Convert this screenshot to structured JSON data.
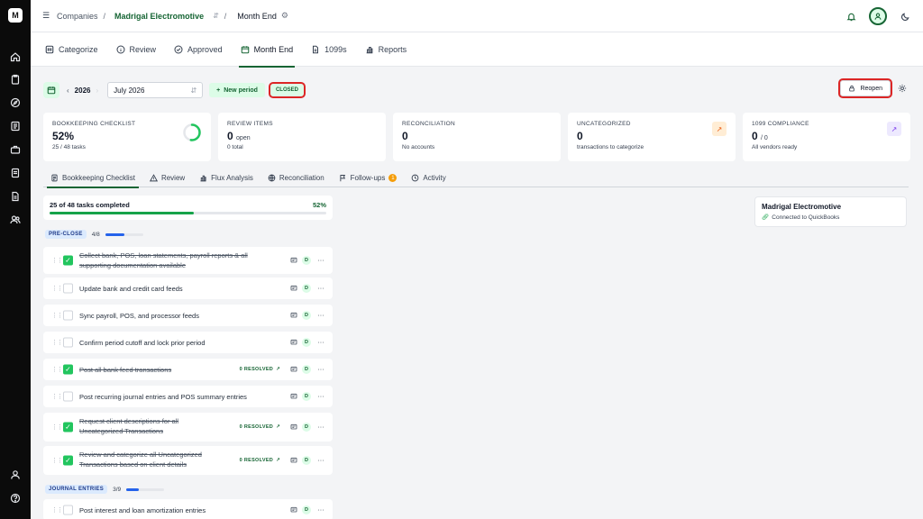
{
  "app": {
    "logo_letter": "M"
  },
  "breadcrumb": {
    "root": "Companies",
    "company": "Madrigal Electromotive",
    "page": "Month End"
  },
  "nav_tabs": [
    {
      "label": "Categorize",
      "icon": "categorize-icon"
    },
    {
      "label": "Review",
      "icon": "info-circle-icon"
    },
    {
      "label": "Approved",
      "icon": "check-circle-icon"
    },
    {
      "label": "Month End",
      "icon": "calendar-icon",
      "active": true
    },
    {
      "label": "1099s",
      "icon": "document-icon"
    },
    {
      "label": "Reports",
      "icon": "bar-chart-icon"
    }
  ],
  "toolbar": {
    "year": "2026",
    "month": "July 2026",
    "new_period_label": "New period",
    "status": "CLOSED",
    "reopen_label": "Reopen"
  },
  "cards": [
    {
      "title": "BOOKKEEPING CHECKLIST",
      "value": "52%",
      "suffix": "",
      "sub": "25 / 48 tasks",
      "progress": 0.52
    },
    {
      "title": "REVIEW ITEMS",
      "value": "0",
      "suffix": "open",
      "sub": "0 total"
    },
    {
      "title": "RECONCILIATION",
      "value": "0",
      "suffix": "",
      "sub": "No accounts"
    },
    {
      "title": "UNCATEGORIZED",
      "value": "0",
      "suffix": "",
      "sub": "transactions to categorize"
    },
    {
      "title": "1099 COMPLIANCE",
      "value": "0",
      "suffix": "/ 0",
      "sub": "All vendors ready"
    }
  ],
  "sub_tabs": [
    {
      "label": "Bookkeeping Checklist",
      "active": true
    },
    {
      "label": "Review"
    },
    {
      "label": "Flux Analysis"
    },
    {
      "label": "Reconciliation"
    },
    {
      "label": "Follow-ups",
      "badge": "1"
    },
    {
      "label": "Activity"
    }
  ],
  "progress": {
    "label": "25 of 48 tasks completed",
    "percent_label": "52%",
    "value": 0.52
  },
  "sections": [
    {
      "tag": "PRE-CLOSE",
      "count": "4/8",
      "value": 0.5
    },
    {
      "tag": "JOURNAL ENTRIES",
      "count": "3/9",
      "value": 0.33
    }
  ],
  "tasks": [
    {
      "line1": "Collect bank, POS, loan statements, payroll reports & all",
      "line2": "supporting documentation available",
      "done": true,
      "resolved": "",
      "assignee": "D"
    },
    {
      "line1": "Update bank and credit card feeds",
      "line2": "",
      "done": false,
      "resolved": "",
      "assignee": "D"
    },
    {
      "line1": "Sync payroll, POS, and processor feeds",
      "line2": "",
      "done": false,
      "resolved": "",
      "assignee": "D"
    },
    {
      "line1": "Confirm period cutoff and lock prior period",
      "line2": "",
      "done": false,
      "resolved": "",
      "assignee": "D"
    },
    {
      "line1": "Post all bank feed transactions",
      "line2": "",
      "done": true,
      "resolved": "0 RESOLVED",
      "assignee": "D"
    },
    {
      "line1": "Post recurring journal entries and POS summary entries",
      "line2": "",
      "done": false,
      "resolved": "",
      "assignee": "D"
    },
    {
      "line1": "Request client descriptions for all",
      "line2": "Uncategorized Transactions",
      "done": true,
      "resolved": "0 RESOLVED",
      "assignee": "D"
    },
    {
      "line1": "Review and categorize all Uncategorized",
      "line2": "Transactions based on client details",
      "done": true,
      "resolved": "0 RESOLVED",
      "assignee": "D"
    },
    {
      "line1": "Post interest and loan amortization entries",
      "line2": "",
      "done": false,
      "resolved": "",
      "assignee": "D"
    }
  ],
  "connection": {
    "company": "Madrigal Electromotive",
    "status": "Connected to QuickBooks"
  }
}
